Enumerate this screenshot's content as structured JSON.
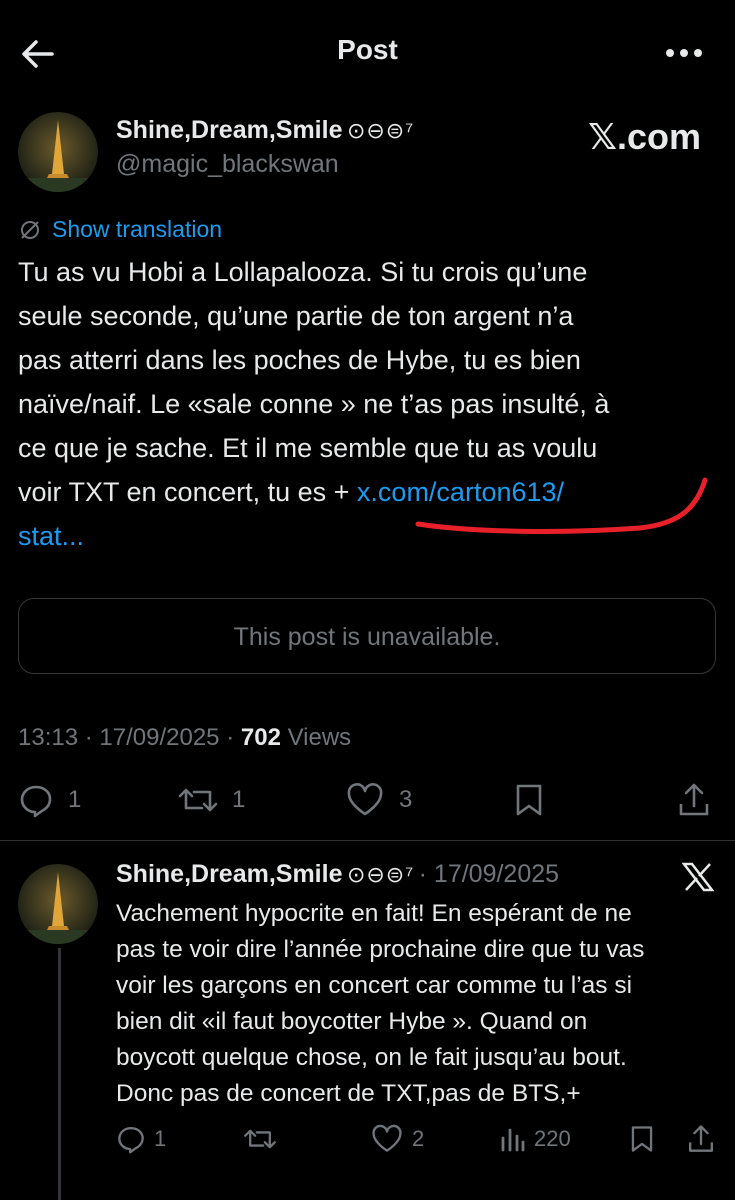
{
  "header": {
    "title": "Post"
  },
  "post": {
    "author_name": "Shine,Dream,Smile",
    "author_badges": "⊙⊖⊜⁷",
    "handle": "@magic_blackswan",
    "brand": "𝕏.com",
    "show_translation": "Show translation",
    "text_lines": [
      "Tu as vu Hobi a Lollapalooza. Si tu crois qu’une",
      "seule seconde, qu’une partie de ton argent n’a",
      "pas atterri dans les poches de Hybe, tu es bien",
      "naïve/naif. Le «sale conne » ne t’as pas insulté, à",
      "ce que je sache. Et il me semble que tu as voulu",
      "voir TXT en concert, tu es + "
    ],
    "link_part1": "x.com/carton613/",
    "link_part2": "stat...",
    "unavailable": "This post is unavailable.",
    "time": "13:13",
    "date": "17/09/2025",
    "views_count": "702",
    "views_label": "Views",
    "sep": "·",
    "replies": "1",
    "reposts": "1",
    "likes": "3"
  },
  "reply": {
    "author_name": "Shine,Dream,Smile",
    "author_badges": "⊙⊖⊜⁷",
    "date": "· 17/09/2025",
    "text_lines": [
      "Vachement hypocrite en fait! En espérant de ne",
      "pas te voir dire l’année prochaine dire que tu vas",
      "voir les garçons en concert car comme tu l’as si",
      "bien dit «il faut boycotter Hybe ». Quand on",
      "boycott quelque chose, on le fait jusqu’au bout.",
      "Donc pas de concert de TXT,pas de BTS,+"
    ],
    "replies": "1",
    "likes": "2",
    "views": "220"
  },
  "colors": {
    "accent": "#1d9bf0",
    "annotation": "#e8202a",
    "background": "#000000"
  }
}
